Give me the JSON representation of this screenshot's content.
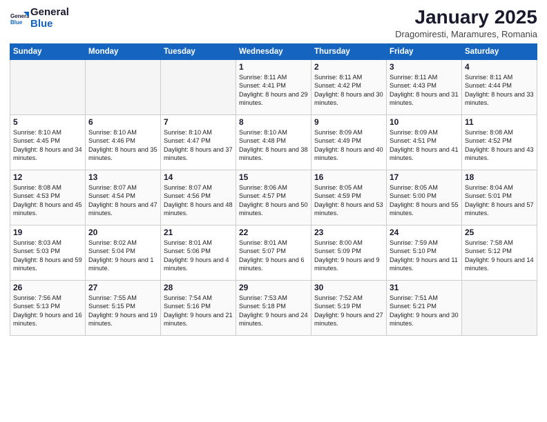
{
  "header": {
    "logo_general": "General",
    "logo_blue": "Blue",
    "month_title": "January 2025",
    "subtitle": "Dragomiresti, Maramures, Romania"
  },
  "weekdays": [
    "Sunday",
    "Monday",
    "Tuesday",
    "Wednesday",
    "Thursday",
    "Friday",
    "Saturday"
  ],
  "weeks": [
    [
      {
        "day": "",
        "info": ""
      },
      {
        "day": "",
        "info": ""
      },
      {
        "day": "",
        "info": ""
      },
      {
        "day": "1",
        "info": "Sunrise: 8:11 AM\nSunset: 4:41 PM\nDaylight: 8 hours and 29 minutes."
      },
      {
        "day": "2",
        "info": "Sunrise: 8:11 AM\nSunset: 4:42 PM\nDaylight: 8 hours and 30 minutes."
      },
      {
        "day": "3",
        "info": "Sunrise: 8:11 AM\nSunset: 4:43 PM\nDaylight: 8 hours and 31 minutes."
      },
      {
        "day": "4",
        "info": "Sunrise: 8:11 AM\nSunset: 4:44 PM\nDaylight: 8 hours and 33 minutes."
      }
    ],
    [
      {
        "day": "5",
        "info": "Sunrise: 8:10 AM\nSunset: 4:45 PM\nDaylight: 8 hours and 34 minutes."
      },
      {
        "day": "6",
        "info": "Sunrise: 8:10 AM\nSunset: 4:46 PM\nDaylight: 8 hours and 35 minutes."
      },
      {
        "day": "7",
        "info": "Sunrise: 8:10 AM\nSunset: 4:47 PM\nDaylight: 8 hours and 37 minutes."
      },
      {
        "day": "8",
        "info": "Sunrise: 8:10 AM\nSunset: 4:48 PM\nDaylight: 8 hours and 38 minutes."
      },
      {
        "day": "9",
        "info": "Sunrise: 8:09 AM\nSunset: 4:49 PM\nDaylight: 8 hours and 40 minutes."
      },
      {
        "day": "10",
        "info": "Sunrise: 8:09 AM\nSunset: 4:51 PM\nDaylight: 8 hours and 41 minutes."
      },
      {
        "day": "11",
        "info": "Sunrise: 8:08 AM\nSunset: 4:52 PM\nDaylight: 8 hours and 43 minutes."
      }
    ],
    [
      {
        "day": "12",
        "info": "Sunrise: 8:08 AM\nSunset: 4:53 PM\nDaylight: 8 hours and 45 minutes."
      },
      {
        "day": "13",
        "info": "Sunrise: 8:07 AM\nSunset: 4:54 PM\nDaylight: 8 hours and 47 minutes."
      },
      {
        "day": "14",
        "info": "Sunrise: 8:07 AM\nSunset: 4:56 PM\nDaylight: 8 hours and 48 minutes."
      },
      {
        "day": "15",
        "info": "Sunrise: 8:06 AM\nSunset: 4:57 PM\nDaylight: 8 hours and 50 minutes."
      },
      {
        "day": "16",
        "info": "Sunrise: 8:05 AM\nSunset: 4:59 PM\nDaylight: 8 hours and 53 minutes."
      },
      {
        "day": "17",
        "info": "Sunrise: 8:05 AM\nSunset: 5:00 PM\nDaylight: 8 hours and 55 minutes."
      },
      {
        "day": "18",
        "info": "Sunrise: 8:04 AM\nSunset: 5:01 PM\nDaylight: 8 hours and 57 minutes."
      }
    ],
    [
      {
        "day": "19",
        "info": "Sunrise: 8:03 AM\nSunset: 5:03 PM\nDaylight: 8 hours and 59 minutes."
      },
      {
        "day": "20",
        "info": "Sunrise: 8:02 AM\nSunset: 5:04 PM\nDaylight: 9 hours and 1 minute."
      },
      {
        "day": "21",
        "info": "Sunrise: 8:01 AM\nSunset: 5:06 PM\nDaylight: 9 hours and 4 minutes."
      },
      {
        "day": "22",
        "info": "Sunrise: 8:01 AM\nSunset: 5:07 PM\nDaylight: 9 hours and 6 minutes."
      },
      {
        "day": "23",
        "info": "Sunrise: 8:00 AM\nSunset: 5:09 PM\nDaylight: 9 hours and 9 minutes."
      },
      {
        "day": "24",
        "info": "Sunrise: 7:59 AM\nSunset: 5:10 PM\nDaylight: 9 hours and 11 minutes."
      },
      {
        "day": "25",
        "info": "Sunrise: 7:58 AM\nSunset: 5:12 PM\nDaylight: 9 hours and 14 minutes."
      }
    ],
    [
      {
        "day": "26",
        "info": "Sunrise: 7:56 AM\nSunset: 5:13 PM\nDaylight: 9 hours and 16 minutes."
      },
      {
        "day": "27",
        "info": "Sunrise: 7:55 AM\nSunset: 5:15 PM\nDaylight: 9 hours and 19 minutes."
      },
      {
        "day": "28",
        "info": "Sunrise: 7:54 AM\nSunset: 5:16 PM\nDaylight: 9 hours and 21 minutes."
      },
      {
        "day": "29",
        "info": "Sunrise: 7:53 AM\nSunset: 5:18 PM\nDaylight: 9 hours and 24 minutes."
      },
      {
        "day": "30",
        "info": "Sunrise: 7:52 AM\nSunset: 5:19 PM\nDaylight: 9 hours and 27 minutes."
      },
      {
        "day": "31",
        "info": "Sunrise: 7:51 AM\nSunset: 5:21 PM\nDaylight: 9 hours and 30 minutes."
      },
      {
        "day": "",
        "info": ""
      }
    ]
  ]
}
